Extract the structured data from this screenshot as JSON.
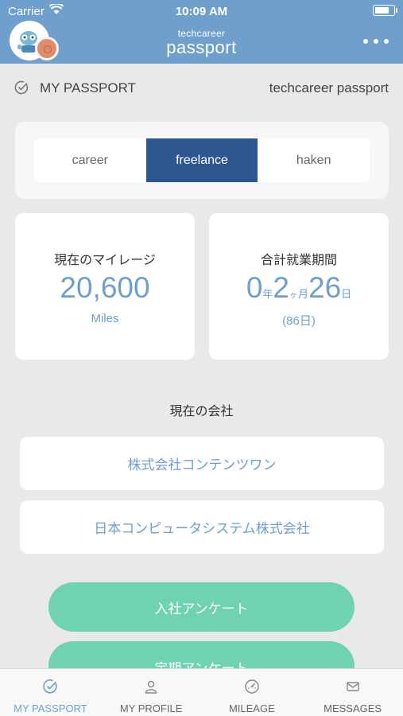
{
  "status_bar": {
    "carrier": "Carrier",
    "time": "10:09 AM",
    "battery_level": 0.8
  },
  "header": {
    "brand_small": "techcareer",
    "brand_big": "passport"
  },
  "title_row": {
    "left": "MY PASSPORT",
    "right": "techcareer passport"
  },
  "segments": [
    {
      "label": "career",
      "active": false
    },
    {
      "label": "freelance",
      "active": true
    },
    {
      "label": "haken",
      "active": false
    }
  ],
  "mileage": {
    "label": "現在のマイレージ",
    "value": "20,600",
    "unit": "Miles"
  },
  "employment": {
    "label": "合計就業期間",
    "years": "0",
    "years_unit": "年",
    "months": "2",
    "months_unit_small": "ヶ",
    "months_unit": "月",
    "days": "26",
    "days_unit": "日",
    "total": "(86日)"
  },
  "current_company": {
    "label": "現在の会社",
    "companies": [
      "株式会社コンテンツワン",
      "日本コンピュータシステム株式会社"
    ]
  },
  "buttons": {
    "join_survey": "入社アンケート",
    "periodic_survey": "定期アンケート"
  },
  "tabs": [
    {
      "label": "MY PASSPORT",
      "icon": "check-circle-icon",
      "active": true
    },
    {
      "label": "MY PROFILE",
      "icon": "person-icon",
      "active": false
    },
    {
      "label": "MILEAGE",
      "icon": "gauge-icon",
      "active": false
    },
    {
      "label": "MESSAGES",
      "icon": "envelope-icon",
      "active": false
    }
  ],
  "colors": {
    "header": "#6f9fcd",
    "accent": "#6f9fcd",
    "segment_active": "#2e5791",
    "button": "#6fd3b0"
  }
}
